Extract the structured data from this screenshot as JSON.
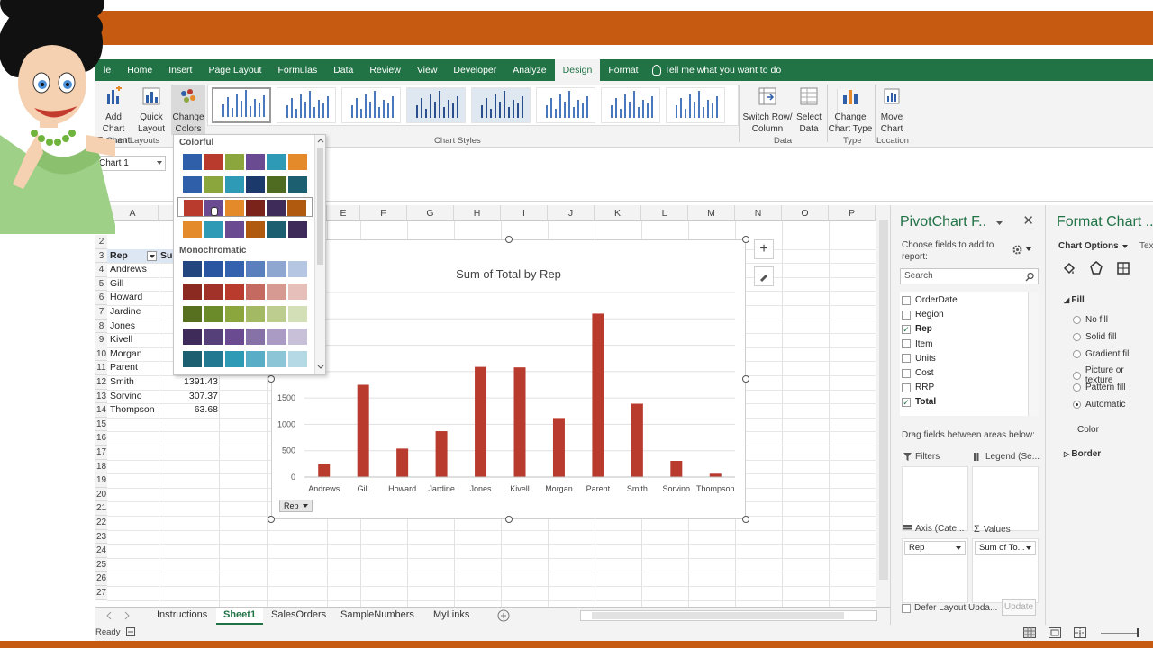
{
  "ribbon_tabs": [
    "le",
    "Home",
    "Insert",
    "Page Layout",
    "Formulas",
    "Data",
    "Review",
    "View",
    "Developer",
    "Analyze",
    "Design",
    "Format"
  ],
  "tell_me": "Tell me what you want to do",
  "ribbon": {
    "add_chart_element": [
      "Add Chart",
      "Element"
    ],
    "quick_layout": [
      "Quick",
      "Layout"
    ],
    "change_colors": [
      "Change",
      "Colors"
    ],
    "chart_layouts_label": "Chart Layouts",
    "chart_styles_label": "Chart Styles",
    "switch_row_col": [
      "Switch Row/",
      "Column"
    ],
    "select_data": [
      "Select",
      "Data"
    ],
    "data_label": "Data",
    "change_chart_type": [
      "Change",
      "Chart Type"
    ],
    "type_label": "Type",
    "move_chart": [
      "Move",
      "Chart"
    ],
    "location_label": "Location"
  },
  "name_box": "Chart 1",
  "columns": [
    "A",
    "",
    "",
    "",
    "E",
    "F",
    "G",
    "H",
    "I",
    "J",
    "K",
    "L",
    "M",
    "N",
    "O",
    "P"
  ],
  "rows": [
    "2",
    "3",
    "4",
    "5",
    "6",
    "7",
    "8",
    "9",
    "10",
    "11",
    "12",
    "13",
    "14",
    "15",
    "16",
    "17",
    "18",
    "19",
    "20",
    "21",
    "22",
    "23",
    "24",
    "25",
    "26",
    "27"
  ],
  "table": {
    "header": [
      "Rep",
      "Su"
    ],
    "reps": [
      "Andrews",
      "Gill",
      "Howard",
      "Jardine",
      "Jones",
      "Kivell",
      "Morgan",
      "Parent",
      "Smith",
      "Sorvino",
      "Thompson"
    ],
    "visible_sums": [
      {
        "rep": "Smith",
        "value": "1391.43"
      },
      {
        "rep": "Sorvino",
        "value": "307.37"
      },
      {
        "rep": "Thompson",
        "value": "63.68"
      }
    ]
  },
  "colors_menu": {
    "colorful_label": "Colorful",
    "monochromatic_label": "Monochromatic",
    "colorful_rows": [
      [
        "#2e5fa8",
        "#b83b2e",
        "#8aa63c",
        "#6a4a91",
        "#2e9ab6",
        "#e58a2b"
      ],
      [
        "#2e5fa8",
        "#8aa63c",
        "#2e9ab6",
        "#1b3a6b",
        "#4f6b22",
        "#1b5f71"
      ],
      [
        "#b83b2e",
        "#6a4a91",
        "#e58a2b",
        "#7a231b",
        "#3e2b59",
        "#b05a10"
      ],
      [
        "#e58a2b",
        "#2e9ab6",
        "#6a4a91",
        "#b05a10",
        "#1b5f71",
        "#3e2b59"
      ]
    ],
    "mono_rows": [
      [
        "#23467e",
        "#2a55a0",
        "#3562ae",
        "#5a80bd",
        "#8ea7d1",
        "#b4c6e2"
      ],
      [
        "#8a2a21",
        "#a0322a",
        "#b83b2e",
        "#c56a60",
        "#d79a93",
        "#e6bfba"
      ],
      [
        "#56701f",
        "#6b8a2a",
        "#8aa63c",
        "#a3b964",
        "#bccd8f",
        "#d3dfb6"
      ],
      [
        "#3e2b59",
        "#55407a",
        "#6a4a91",
        "#8772a8",
        "#a99bc3",
        "#c8bfd9"
      ],
      [
        "#1b5f71",
        "#237891",
        "#2e9ab6",
        "#5aadc6",
        "#8cc5d6",
        "#b5d9e5"
      ]
    ]
  },
  "chart_data": {
    "type": "bar",
    "title": "Sum of Total by Rep",
    "categories": [
      "Andrews",
      "Gill",
      "Howard",
      "Jardine",
      "Jones",
      "Kivell",
      "Morgan",
      "Parent",
      "Smith",
      "Sorvino",
      "Thompson"
    ],
    "values": [
      250,
      1750,
      540,
      870,
      2090,
      2080,
      1120,
      3100,
      1391.43,
      307.37,
      63.68
    ],
    "y_ticks": [
      "0",
      "500",
      "1000",
      "1500"
    ],
    "ylim": [
      0,
      3500
    ],
    "grid": true,
    "bar_color": "#b83b2e",
    "axis_button": "Rep"
  },
  "pivot": {
    "title": "PivotChart F..",
    "subtitle": "Choose fields to add to report:",
    "search_placeholder": "Search",
    "fields": [
      {
        "name": "OrderDate",
        "checked": false
      },
      {
        "name": "Region",
        "checked": false
      },
      {
        "name": "Rep",
        "checked": true
      },
      {
        "name": "Item",
        "checked": false
      },
      {
        "name": "Units",
        "checked": false
      },
      {
        "name": "Cost",
        "checked": false
      },
      {
        "name": "RRP",
        "checked": false
      },
      {
        "name": "Total",
        "checked": true
      }
    ],
    "drag_label": "Drag fields between areas below:",
    "filters": "Filters",
    "legend": "Legend (Se...",
    "axis": "Axis (Cate...",
    "values": "Values",
    "axis_chip": "Rep",
    "values_chip": "Sum of To...",
    "defer": "Defer Layout Upda...",
    "update": "Update"
  },
  "format_pane": {
    "title": "Format Chart ...",
    "options": "Chart Options",
    "text": "Tex",
    "fill_label": "Fill",
    "fill_options": [
      "No fill",
      "Solid fill",
      "Gradient fill",
      "Picture or texture",
      "Pattern fill",
      "Automatic"
    ],
    "selected_fill": "Automatic",
    "color_label": "Color",
    "border_label": "Border"
  },
  "sheet_tabs": [
    "Instructions",
    "Sheet1",
    "SalesOrders",
    "SampleNumbers",
    "MyLinks"
  ],
  "active_sheet": "Sheet1",
  "status": "Ready"
}
